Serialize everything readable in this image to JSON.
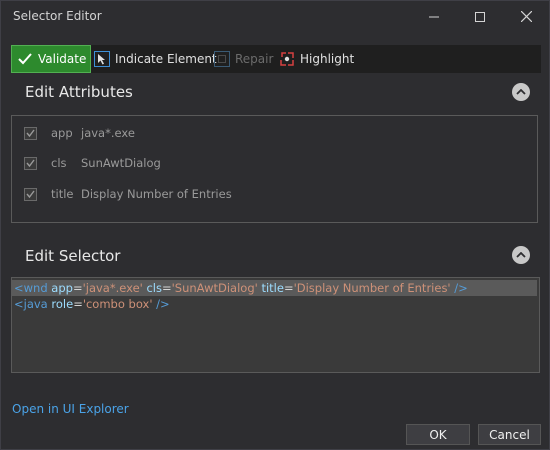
{
  "window": {
    "title": "Selector Editor"
  },
  "toolbar": {
    "validate_label": "Validate",
    "indicate_label": "Indicate Element",
    "repair_label": "Repair",
    "highlight_label": "Highlight"
  },
  "attributes": {
    "heading": "Edit Attributes",
    "items": [
      {
        "checked": true,
        "name": "app",
        "value": "java*.exe"
      },
      {
        "checked": true,
        "name": "cls",
        "value": "SunAwtDialog"
      },
      {
        "checked": true,
        "name": "title",
        "value": "Display Number of Entries"
      }
    ]
  },
  "selector": {
    "heading": "Edit Selector",
    "line1": {
      "open": "<wnd",
      "a1_name": "app",
      "a1_val": "'java*.exe'",
      "a2_name": "cls",
      "a2_val": "'SunAwtDialog'",
      "a3_name": "title",
      "a3_val": "'Display Number of Entries'",
      "close": "/>"
    },
    "line2": {
      "open": "<java",
      "a1_name": "role",
      "a1_val": "'combo box'",
      "close": "/>"
    }
  },
  "footer": {
    "link_label": "Open in UI Explorer",
    "ok_label": "OK",
    "cancel_label": "Cancel"
  },
  "colors": {
    "background": "#2d2d30",
    "validate_green": "#2d8a2d",
    "link_blue": "#4aa3e8",
    "tag_blue": "#569cd6",
    "value_orange": "#ce9178"
  }
}
